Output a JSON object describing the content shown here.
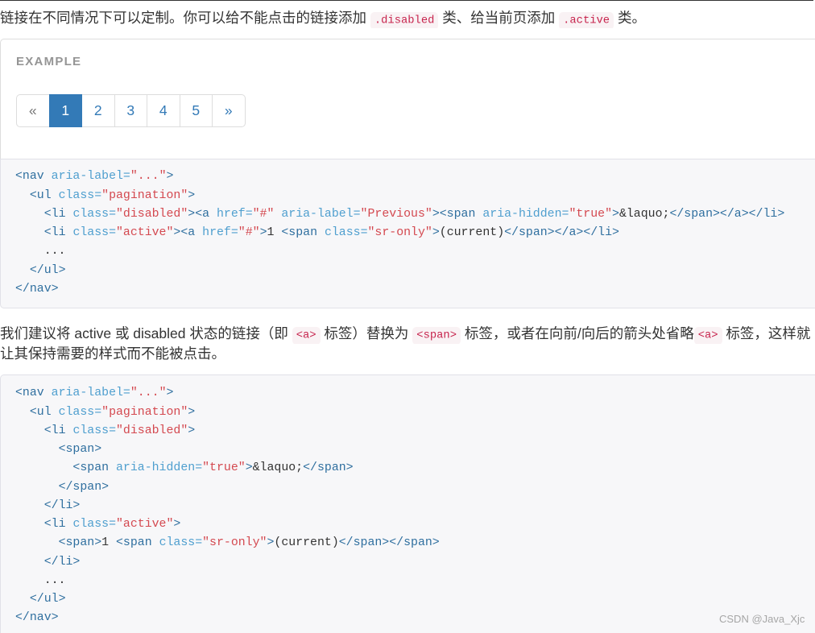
{
  "colors": {
    "text": "#333333",
    "accent": "#337ab7",
    "pagination_disabled": "#777777",
    "inline_code": "#c7254e",
    "inline_code_bg": "#f9f2f4",
    "code_bg": "#f7f7f9",
    "syntax_tag": "#2f6f9f",
    "syntax_attr": "#4f9fcf",
    "syntax_string": "#d44950",
    "example_label": "#959595"
  },
  "intro": {
    "segments": [
      {
        "text": "链接在不同情况下可以定制。你可以给不能点击的链接添加 "
      },
      {
        "code": ".disabled"
      },
      {
        "text": " 类、给当前页添加 "
      },
      {
        "code": ".active"
      },
      {
        "text": " 类。"
      }
    ]
  },
  "example": {
    "label": "EXAMPLE",
    "pagination": {
      "items": [
        {
          "label": "«",
          "disabled": true
        },
        {
          "label": "1",
          "active": true
        },
        {
          "label": "2"
        },
        {
          "label": "3"
        },
        {
          "label": "4"
        },
        {
          "label": "5"
        },
        {
          "label": "»"
        }
      ]
    }
  },
  "code_blocks": [
    {
      "lines": [
        [
          {
            "tag": "<nav"
          },
          {
            "text": " "
          },
          {
            "attr": "aria-label="
          },
          {
            "str": "\"...\""
          },
          {
            "tag": ">"
          }
        ],
        [
          {
            "text": "  "
          },
          {
            "tag": "<ul"
          },
          {
            "text": " "
          },
          {
            "attr": "class="
          },
          {
            "str": "\"pagination\""
          },
          {
            "tag": ">"
          }
        ],
        [
          {
            "text": "    "
          },
          {
            "tag": "<li"
          },
          {
            "text": " "
          },
          {
            "attr": "class="
          },
          {
            "str": "\"disabled\""
          },
          {
            "tag": "><a"
          },
          {
            "text": " "
          },
          {
            "attr": "href="
          },
          {
            "str": "\"#\""
          },
          {
            "text": " "
          },
          {
            "attr": "aria-label="
          },
          {
            "str": "\"Previous\""
          },
          {
            "tag": "><span"
          },
          {
            "text": " "
          },
          {
            "attr": "aria-hidden="
          },
          {
            "str": "\"true\""
          },
          {
            "tag": ">"
          },
          {
            "text": "&laquo;"
          },
          {
            "tag": "</span></a></li>"
          }
        ],
        [
          {
            "text": "    "
          },
          {
            "tag": "<li"
          },
          {
            "text": " "
          },
          {
            "attr": "class="
          },
          {
            "str": "\"active\""
          },
          {
            "tag": "><a"
          },
          {
            "text": " "
          },
          {
            "attr": "href="
          },
          {
            "str": "\"#\""
          },
          {
            "tag": ">"
          },
          {
            "text": "1 "
          },
          {
            "tag": "<span"
          },
          {
            "text": " "
          },
          {
            "attr": "class="
          },
          {
            "str": "\"sr-only\""
          },
          {
            "tag": ">"
          },
          {
            "text": "(current)"
          },
          {
            "tag": "</span></a></li>"
          }
        ],
        [
          {
            "text": "    ..."
          }
        ],
        [
          {
            "text": "  "
          },
          {
            "tag": "</ul>"
          }
        ],
        [
          {
            "tag": "</nav>"
          }
        ]
      ]
    },
    {
      "lines": [
        [
          {
            "tag": "<nav"
          },
          {
            "text": " "
          },
          {
            "attr": "aria-label="
          },
          {
            "str": "\"...\""
          },
          {
            "tag": ">"
          }
        ],
        [
          {
            "text": "  "
          },
          {
            "tag": "<ul"
          },
          {
            "text": " "
          },
          {
            "attr": "class="
          },
          {
            "str": "\"pagination\""
          },
          {
            "tag": ">"
          }
        ],
        [
          {
            "text": "    "
          },
          {
            "tag": "<li"
          },
          {
            "text": " "
          },
          {
            "attr": "class="
          },
          {
            "str": "\"disabled\""
          },
          {
            "tag": ">"
          }
        ],
        [
          {
            "text": "      "
          },
          {
            "tag": "<span>"
          }
        ],
        [
          {
            "text": "        "
          },
          {
            "tag": "<span"
          },
          {
            "text": " "
          },
          {
            "attr": "aria-hidden="
          },
          {
            "str": "\"true\""
          },
          {
            "tag": ">"
          },
          {
            "text": "&laquo;"
          },
          {
            "tag": "</span>"
          }
        ],
        [
          {
            "text": "      "
          },
          {
            "tag": "</span>"
          }
        ],
        [
          {
            "text": "    "
          },
          {
            "tag": "</li>"
          }
        ],
        [
          {
            "text": "    "
          },
          {
            "tag": "<li"
          },
          {
            "text": " "
          },
          {
            "attr": "class="
          },
          {
            "str": "\"active\""
          },
          {
            "tag": ">"
          }
        ],
        [
          {
            "text": "      "
          },
          {
            "tag": "<span>"
          },
          {
            "text": "1 "
          },
          {
            "tag": "<span"
          },
          {
            "text": " "
          },
          {
            "attr": "class="
          },
          {
            "str": "\"sr-only\""
          },
          {
            "tag": ">"
          },
          {
            "text": "(current)"
          },
          {
            "tag": "</span></span>"
          }
        ],
        [
          {
            "text": "    "
          },
          {
            "tag": "</li>"
          }
        ],
        [
          {
            "text": "    ..."
          }
        ],
        [
          {
            "text": "  "
          },
          {
            "tag": "</ul>"
          }
        ],
        [
          {
            "tag": "</nav>"
          }
        ]
      ]
    }
  ],
  "note": {
    "lines": [
      [
        {
          "text": "我们建议将 active 或 disabled 状态的链接（即 "
        },
        {
          "code": "<a>"
        },
        {
          "text": " 标签）替换为 "
        },
        {
          "code": "<span>"
        },
        {
          "text": " 标签，或者在向前/向后的箭头处省略"
        },
        {
          "code": "<a>"
        },
        {
          "text": " 标签，这样就"
        }
      ],
      [
        {
          "text": "让其保持需要的样式而不能被点击。"
        }
      ]
    ]
  },
  "watermark": "CSDN @Java_Xjc"
}
